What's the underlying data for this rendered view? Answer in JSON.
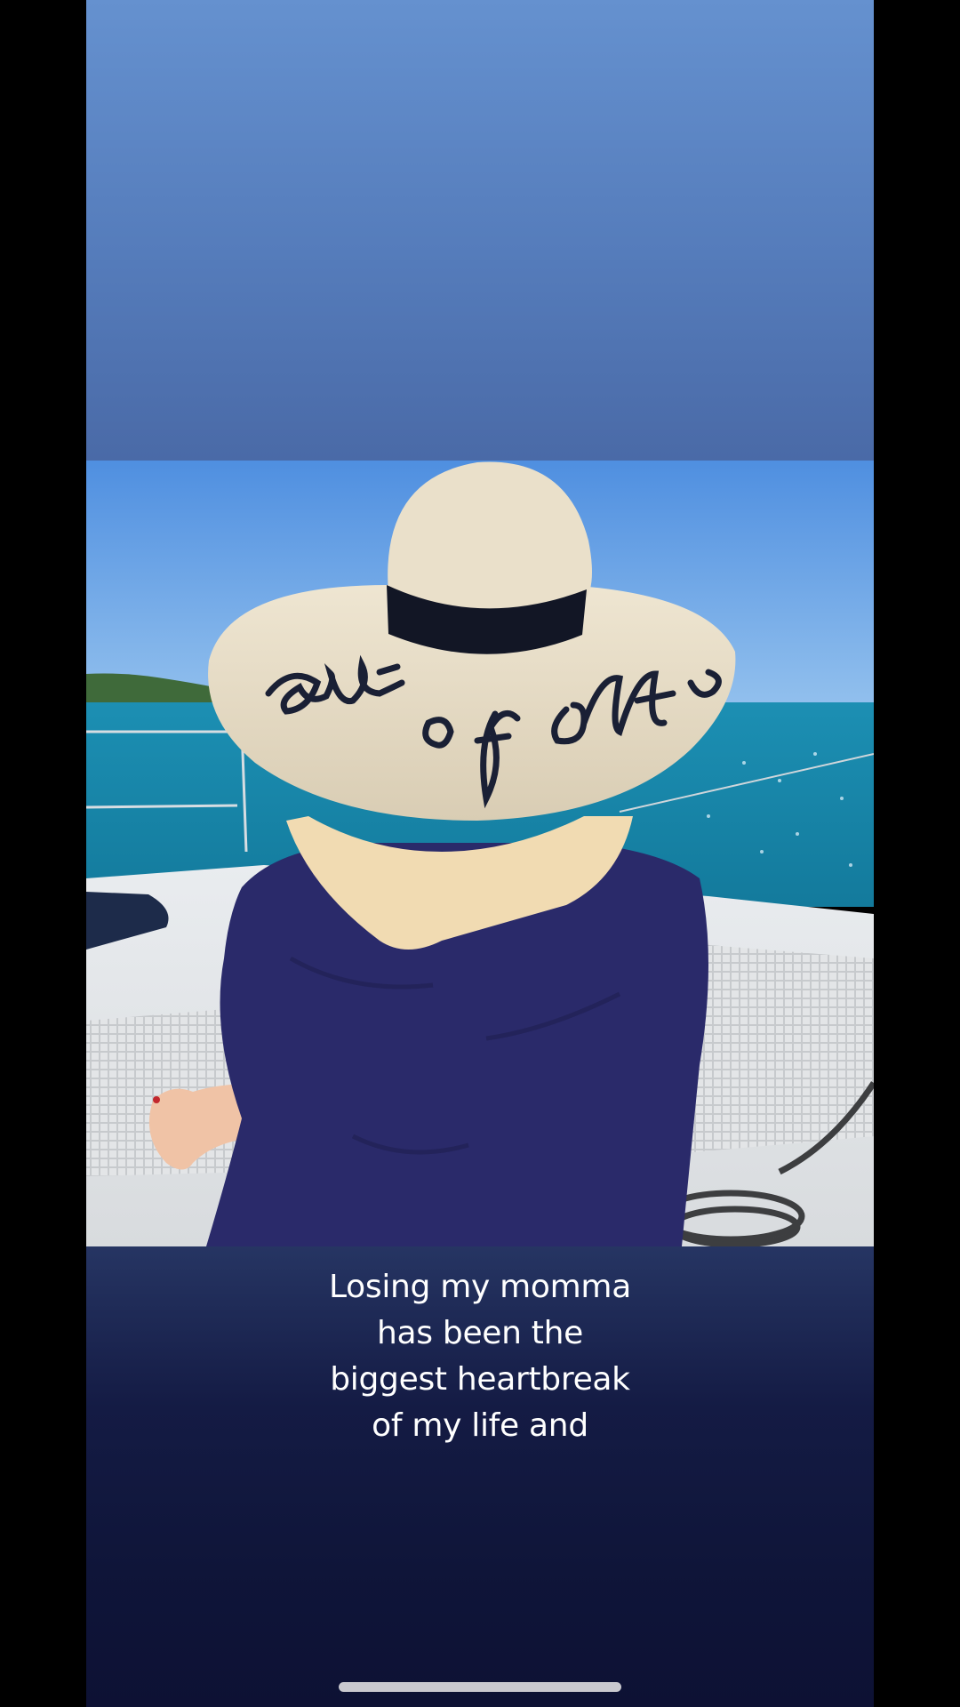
{
  "story": {
    "caption_lines": [
      "Losing my momma",
      "has been the",
      "biggest heartbreak",
      "of my life and"
    ],
    "photo": {
      "hat_text": "out of office"
    }
  },
  "colors": {
    "top_gradient": [
      "#6591cf",
      "#4a6aa7"
    ],
    "bottom_gradient": [
      "#263563",
      "#0d1134"
    ],
    "caption_text": "#ffffff"
  }
}
